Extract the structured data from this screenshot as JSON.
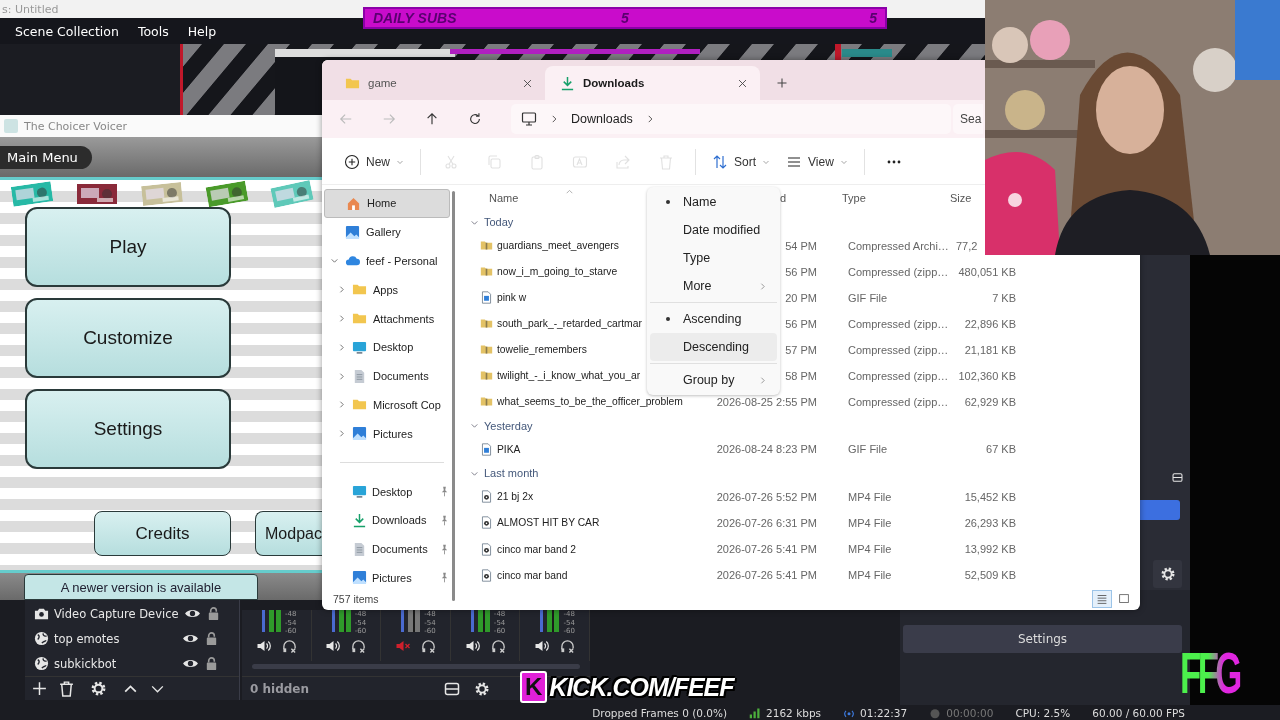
{
  "obs": {
    "title": "s: Untitled",
    "menu": [
      "Scene Collection",
      "Tools",
      "Help"
    ],
    "daily_subs": {
      "label": "DAILY SUBS",
      "left_count": "5",
      "right_count": "5"
    },
    "sources": [
      {
        "name": "Video Capture Device",
        "kind": "camera"
      },
      {
        "name": "top emotes",
        "kind": "browser"
      },
      {
        "name": "subkickbot",
        "kind": "browser"
      }
    ],
    "mixer": [
      {
        "scale": [
          "-48",
          "-54",
          "-60"
        ],
        "muted": false
      },
      {
        "scale": [
          "-48",
          "-54",
          "-60"
        ],
        "muted": false
      },
      {
        "scale": [
          "-48",
          "-54",
          "-60"
        ],
        "muted": true
      },
      {
        "scale": [
          "-48",
          "-54",
          "-60"
        ],
        "muted": false
      },
      {
        "scale": [
          "-48",
          "-54",
          "-60"
        ],
        "muted": false
      }
    ],
    "hidden_label": "0 hidden",
    "settings_button": "Settings",
    "status_bar": [
      {
        "text": "Dropped Frames 0 (0.0%)",
        "kind": "plain"
      },
      {
        "text": "2162 kbps",
        "kind": "bitrate"
      },
      {
        "text": "01:22:37",
        "kind": "stream"
      },
      {
        "text": "00:00:00",
        "kind": "record"
      },
      {
        "text": "CPU: 2.5%",
        "kind": "plain"
      },
      {
        "text": "60.00 / 60.00 FPS",
        "kind": "plain"
      }
    ]
  },
  "game": {
    "title": "The Choicer Voicer",
    "header": "Main Menu",
    "menu_buttons": [
      "Play",
      "Customize",
      "Settings"
    ],
    "small_buttons": [
      "Credits",
      "Modpac"
    ],
    "notice": "A newer version is available"
  },
  "explorer": {
    "tabs": [
      {
        "label": "game",
        "kind": "folder",
        "selected": false
      },
      {
        "label": "Downloads",
        "kind": "download",
        "selected": true
      }
    ],
    "breadcrumb": [
      "Downloads"
    ],
    "search_placeholder": "Sea",
    "toolbar": [
      {
        "kind": "new",
        "label": "New",
        "disabled": false
      },
      {
        "kind": "cut",
        "disabled": true
      },
      {
        "kind": "copy",
        "disabled": true
      },
      {
        "kind": "paste",
        "disabled": true
      },
      {
        "kind": "rename",
        "disabled": true
      },
      {
        "kind": "share",
        "disabled": true
      },
      {
        "kind": "delete",
        "disabled": true
      },
      {
        "kind": "sort",
        "label": "Sort",
        "disabled": false
      },
      {
        "kind": "view",
        "label": "View",
        "disabled": false
      },
      {
        "kind": "more",
        "disabled": false
      }
    ],
    "nav": [
      {
        "label": "Home",
        "kind": "home",
        "selected": true
      },
      {
        "label": "Gallery",
        "kind": "gallery",
        "selected": false
      },
      {
        "label": "feef - Personal",
        "kind": "cloud",
        "selected": false,
        "expanded": true,
        "children": [
          {
            "label": "Apps",
            "kind": "folder",
            "selected": false,
            "expanded": false
          },
          {
            "label": "Attachments",
            "kind": "folder",
            "selected": false,
            "expanded": false
          },
          {
            "label": "Desktop",
            "kind": "desktop",
            "selected": false,
            "expanded": false
          },
          {
            "label": "Documents",
            "kind": "document",
            "selected": false,
            "expanded": false
          },
          {
            "label": "Microsoft Cop",
            "kind": "folder",
            "selected": false,
            "expanded": false
          },
          {
            "label": "Pictures",
            "kind": "gallery",
            "selected": false,
            "expanded": false
          }
        ]
      }
    ],
    "pinned": [
      {
        "label": "Desktop",
        "kind": "desktop"
      },
      {
        "label": "Downloads",
        "kind": "download"
      },
      {
        "label": "Documents",
        "kind": "document"
      },
      {
        "label": "Pictures",
        "kind": "gallery"
      }
    ],
    "columns": [
      "Name",
      "d",
      "Type",
      "Size"
    ],
    "groups": [
      {
        "label": "Today",
        "expanded": true,
        "rows": [
          {
            "name": "guardians_meet_avengers",
            "kind": "zip",
            "date": "54 PM",
            "type": "Compressed Archi…",
            "size": "77,2",
            "size_cut": true
          },
          {
            "name": "now_i_m_going_to_starve",
            "kind": "zip",
            "date": "56 PM",
            "type": "Compressed (zipp…",
            "size": "480,051 KB",
            "size_cut": false
          },
          {
            "name": "pink w",
            "kind": "gif",
            "date": "20 PM",
            "type": "GIF File",
            "size": "7 KB",
            "size_cut": false
          },
          {
            "name": "south_park_-_retarded_cartmar",
            "kind": "zip",
            "date": "56 PM",
            "type": "Compressed (zipp…",
            "size": "22,896 KB",
            "size_cut": false
          },
          {
            "name": "towelie_remembers",
            "kind": "zip",
            "date": "57 PM",
            "type": "Compressed (zipp…",
            "size": "21,181 KB",
            "size_cut": false
          },
          {
            "name": "twilight_-_i_know_what_you_ar",
            "kind": "zip",
            "date": "58 PM",
            "type": "Compressed (zipp…",
            "size": "102,360 KB",
            "size_cut": false
          },
          {
            "name": "what_seems_to_be_the_officer_problem",
            "kind": "zip",
            "date": "2026-08-25 2:55 PM",
            "type": "Compressed (zipp…",
            "size": "62,929 KB",
            "size_cut": false
          }
        ]
      },
      {
        "label": "Yesterday",
        "expanded": true,
        "rows": [
          {
            "name": "PIKA",
            "kind": "gif",
            "date": "2026-08-24 8:23 PM",
            "type": "GIF File",
            "size": "67 KB",
            "size_cut": false
          }
        ]
      },
      {
        "label": "Last month",
        "expanded": true,
        "rows": [
          {
            "name": "21 bj 2x",
            "kind": "video",
            "date": "2026-07-26 5:52 PM",
            "type": "MP4 File",
            "size": "15,452 KB",
            "size_cut": false
          },
          {
            "name": "ALMOST HIT BY CAR",
            "kind": "video",
            "date": "2026-07-26 6:31 PM",
            "type": "MP4 File",
            "size": "26,293 KB",
            "size_cut": false
          },
          {
            "name": "cinco mar band 2",
            "kind": "video",
            "date": "2026-07-26 5:41 PM",
            "type": "MP4 File",
            "size": "13,992 KB",
            "size_cut": false
          },
          {
            "name": "cinco mar band",
            "kind": "video",
            "date": "2026-07-26 5:41 PM",
            "type": "MP4 File",
            "size": "52,509 KB",
            "size_cut": false
          }
        ]
      }
    ],
    "item_count": "757 items",
    "view_modes": [
      {
        "kind": "details",
        "selected": true
      },
      {
        "kind": "tiles",
        "selected": false
      }
    ]
  },
  "sort_menu": {
    "sections": [
      [
        {
          "label": "Name",
          "kind": "option",
          "selected": true,
          "hovered": false
        },
        {
          "label": "Date modified",
          "kind": "option",
          "selected": false,
          "hovered": false
        },
        {
          "label": "Type",
          "kind": "option",
          "selected": false,
          "hovered": false
        },
        {
          "label": "More",
          "kind": "submenu",
          "selected": false,
          "hovered": false
        }
      ],
      [
        {
          "label": "Ascending",
          "kind": "option",
          "selected": true,
          "hovered": false
        },
        {
          "label": "Descending",
          "kind": "option",
          "selected": false,
          "hovered": true
        }
      ],
      [
        {
          "label": "Group by",
          "kind": "submenu",
          "selected": false,
          "hovered": false
        }
      ]
    ]
  },
  "overlays": {
    "kick_badge": "K",
    "kick_text": "KICK.COM/FEEF",
    "logo": "FFG"
  }
}
